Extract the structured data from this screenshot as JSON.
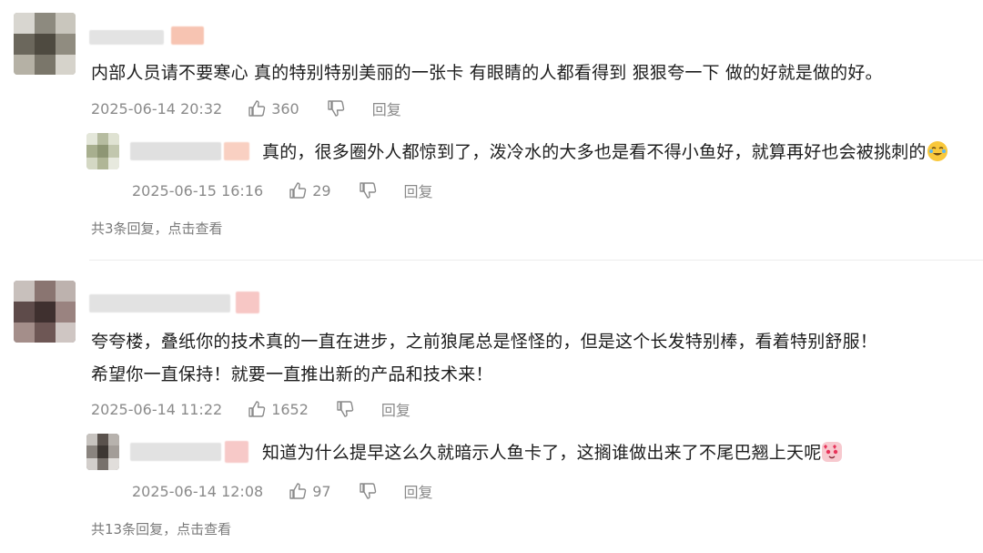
{
  "comments": [
    {
      "text": "内部人员请不要寒心 真的特别特别美丽的一张卡 有眼睛的人都看得到 狠狠夸一下 做的好就是做的好。",
      "time": "2025-06-14 20:32",
      "likes": "360",
      "reply_label": "回复",
      "reply": {
        "text": "真的，很多圈外人都惊到了，泼冷水的大多也是看不得小鱼好，就算再好也会被挑刺的",
        "emoji": "crying-laughing-emoji",
        "time": "2025-06-15 16:16",
        "likes": "29",
        "reply_label": "回复"
      },
      "more_replies": "共3条回复，点击查看"
    },
    {
      "text_line1": "夸夸楼，叠纸你的技术真的一直在进步，之前狼尾总是怪怪的，但是这个长发特别棒，看着特别舒服！",
      "text_line2": "希望你一直保持！就要一直推出新的产品和技术来！",
      "time": "2025-06-14 11:22",
      "likes": "1652",
      "reply_label": "回复",
      "reply": {
        "text": "知道为什么提早这么久就暗示人鱼卡了，这搁谁做出来了不尾巴翘上天呢",
        "emoji": "heart-eyes-emoji",
        "time": "2025-06-14 12:08",
        "likes": "97",
        "reply_label": "回复"
      },
      "more_replies": "共13条回复，点击查看"
    }
  ],
  "colors": {
    "text": "#1d1d1d",
    "meta": "#8a8a8a",
    "divider": "#ececec",
    "name_blur": "#e2e2e2",
    "name_badge": "#f6c3b4"
  }
}
